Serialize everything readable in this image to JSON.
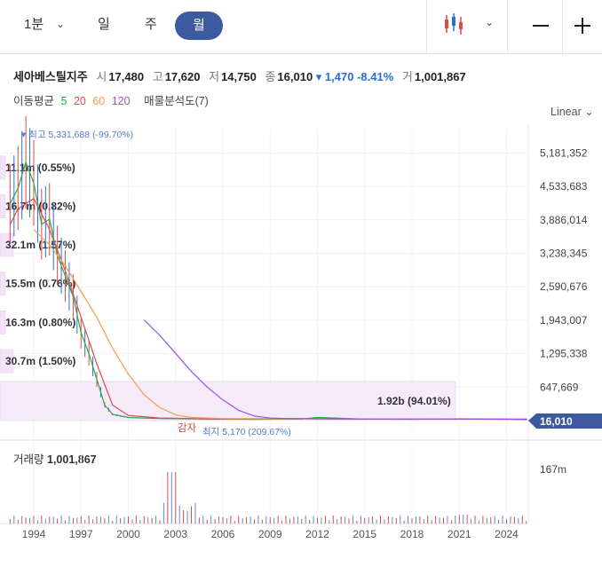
{
  "toolbar": {
    "interval_label": "1분",
    "day_label": "일",
    "week_label": "주",
    "month_label": "월",
    "chevron_icon": "chevron-down-icon",
    "chart_type_icon": "candlestick-icon",
    "zoom_out_icon": "minus-icon",
    "zoom_in_icon": "plus-icon"
  },
  "quote": {
    "name": "세아베스틸지주",
    "open_label": "시",
    "open": "17,480",
    "high_label": "고",
    "high": "17,620",
    "low_label": "저",
    "low": "14,750",
    "close_label": "종",
    "close": "16,010",
    "change": "▾ 1,470 -8.41%",
    "volume_label": "거",
    "volume": "1,001,867"
  },
  "moving_avg": {
    "label": "이동평균",
    "periods": [
      {
        "value": "5",
        "color": "#2aa84a"
      },
      {
        "value": "20",
        "color": "#e04a4a"
      },
      {
        "value": "60",
        "color": "#f0a04b"
      },
      {
        "value": "120",
        "color": "#9a4ee0"
      }
    ],
    "volume_profile_label": "매물분석도(7)"
  },
  "scale_label": "Linear",
  "volume_title": "거래량",
  "volume_value": "1,001,867",
  "chart_data": {
    "type": "line",
    "y_ticks": [
      "5,181,352",
      "4,533,683",
      "3,886,014",
      "3,238,345",
      "2,590,676",
      "1,943,007",
      "1,295,338",
      "647,669"
    ],
    "y_tick_values": [
      5181352,
      4533683,
      3886014,
      3238345,
      2590676,
      1943007,
      1295338,
      647669
    ],
    "x_ticks": [
      "1994",
      "1997",
      "2000",
      "2003",
      "2006",
      "2009",
      "2012",
      "2015",
      "2018",
      "2021",
      "2024"
    ],
    "volume_tick": "167m",
    "current_price": "16,010",
    "high_annotation": "▾ 최고 5,331,688 (-99.70%)",
    "low_annotation": "최지 5,170 (209.67%)",
    "event_label": "감자",
    "volume_profile": [
      {
        "label": "11.1m (0.55%)",
        "price": 4900000,
        "width": 0.02
      },
      {
        "label": "16.7m (0.82%)",
        "price": 4150000,
        "width": 0.02
      },
      {
        "label": "32.1m (1.57%)",
        "price": 3400000,
        "width": 0.05
      },
      {
        "label": "15.5m (0.76%)",
        "price": 2650000,
        "width": 0.02
      },
      {
        "label": "16.3m (0.80%)",
        "price": 1900000,
        "width": 0.02
      },
      {
        "label": "30.7m (1.50%)",
        "price": 1150000,
        "width": 0.05
      },
      {
        "label": "1.92b (94.01%)",
        "price": 380000,
        "width": 1.0
      }
    ],
    "series": [
      {
        "name": "5",
        "color": "#2aa84a",
        "x": [
          1992.5,
          1993,
          1993.5,
          1994,
          1994.5,
          1995,
          1995.5,
          1996,
          1996.5,
          1997,
          1997.5,
          1998,
          1998.5,
          1999,
          2000,
          2002,
          2005,
          2008,
          2011,
          2012,
          2015,
          2018,
          2021,
          2024,
          2025.3
        ],
        "values": [
          4200000,
          4500000,
          5000000,
          4600000,
          3800000,
          3900000,
          3200000,
          2800000,
          2400000,
          1700000,
          1300000,
          800000,
          300000,
          120000,
          60000,
          40000,
          30000,
          25000,
          30000,
          60000,
          30000,
          25000,
          35000,
          30000,
          16010
        ]
      },
      {
        "name": "20",
        "color": "#e04a4a",
        "x": [
          1992.5,
          1993,
          1994,
          1995,
          1996,
          1997,
          1998,
          1999,
          2000,
          2002,
          2006,
          2010,
          2015,
          2020,
          2025.3
        ],
        "values": [
          3800000,
          4100000,
          4300000,
          3700000,
          2900000,
          2000000,
          1100000,
          300000,
          100000,
          50000,
          30000,
          40000,
          30000,
          30000,
          20000
        ]
      },
      {
        "name": "60",
        "color": "#f0a04b",
        "x": [
          1994,
          1995,
          1996,
          1997,
          1998,
          1999,
          2000,
          2001,
          2002,
          2003,
          2004,
          2006,
          2010,
          2015,
          2020,
          2025.3
        ],
        "values": [
          3700000,
          3400000,
          3000000,
          2500000,
          2000000,
          1400000,
          900000,
          500000,
          250000,
          110000,
          60000,
          40000,
          35000,
          30000,
          30000,
          25000
        ]
      },
      {
        "name": "120",
        "color": "#9a4ee0",
        "x": [
          2001,
          2002,
          2003,
          2004,
          2005,
          2006,
          2007,
          2008,
          2009,
          2010,
          2012,
          2016,
          2020,
          2025.3
        ],
        "values": [
          1950000,
          1650000,
          1300000,
          950000,
          650000,
          400000,
          200000,
          90000,
          50000,
          40000,
          35000,
          30000,
          30000,
          28000
        ]
      }
    ]
  }
}
